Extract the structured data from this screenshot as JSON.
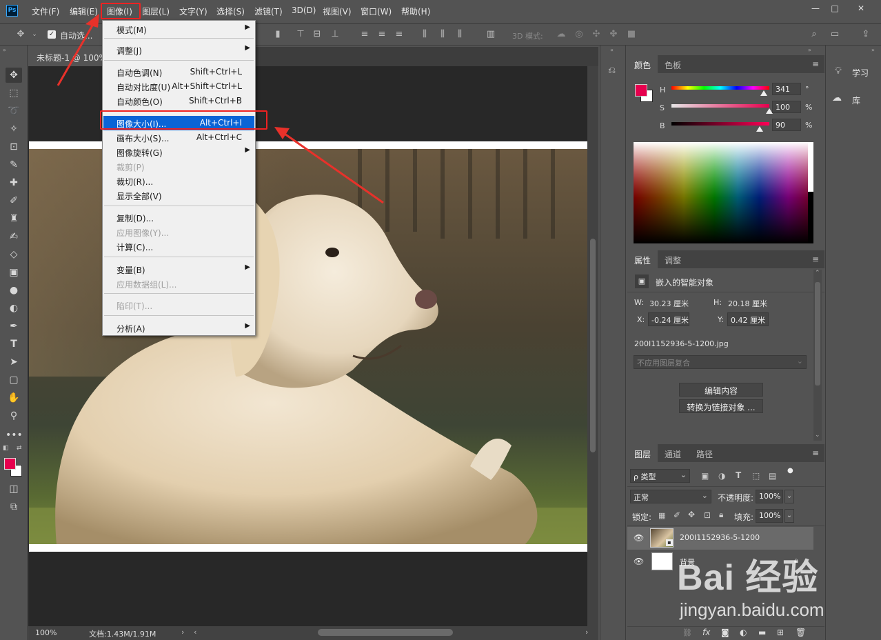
{
  "app": {
    "logo": "Ps"
  },
  "menubar": {
    "items": [
      "文件(F)",
      "编辑(E)",
      "图像(I)",
      "图层(L)",
      "文字(Y)",
      "选择(S)",
      "滤镜(T)",
      "3D(D)",
      "视图(V)",
      "窗口(W)",
      "帮助(H)"
    ],
    "window_controls": [
      "—",
      "□",
      "✕"
    ]
  },
  "options": {
    "auto_select_label": "自动选...",
    "mode_3d": "3D 模式:"
  },
  "document": {
    "tab_title": "未标题-1 @ 100%"
  },
  "status": {
    "zoom": "100%",
    "doc_info": "文档:1.43M/1.91M"
  },
  "image_menu": {
    "items": [
      {
        "label": "模式(M)",
        "shortcut": "",
        "submenu": true,
        "disabled": false
      },
      {
        "label": "调整(J)",
        "shortcut": "",
        "submenu": true,
        "disabled": false
      },
      {
        "label": "自动色调(N)",
        "shortcut": "Shift+Ctrl+L",
        "submenu": false,
        "disabled": false
      },
      {
        "label": "自动对比度(U)",
        "shortcut": "Alt+Shift+Ctrl+L",
        "submenu": false,
        "disabled": false
      },
      {
        "label": "自动颜色(O)",
        "shortcut": "Shift+Ctrl+B",
        "submenu": false,
        "disabled": false
      },
      {
        "label": "图像大小(I)...",
        "shortcut": "Alt+Ctrl+I",
        "submenu": false,
        "disabled": false,
        "highlighted": true
      },
      {
        "label": "画布大小(S)...",
        "shortcut": "Alt+Ctrl+C",
        "submenu": false,
        "disabled": false
      },
      {
        "label": "图像旋转(G)",
        "shortcut": "",
        "submenu": true,
        "disabled": false
      },
      {
        "label": "裁剪(P)",
        "shortcut": "",
        "submenu": false,
        "disabled": true
      },
      {
        "label": "裁切(R)...",
        "shortcut": "",
        "submenu": false,
        "disabled": false
      },
      {
        "label": "显示全部(V)",
        "shortcut": "",
        "submenu": false,
        "disabled": false
      },
      {
        "label": "复制(D)...",
        "shortcut": "",
        "submenu": false,
        "disabled": false
      },
      {
        "label": "应用图像(Y)...",
        "shortcut": "",
        "submenu": false,
        "disabled": true
      },
      {
        "label": "计算(C)...",
        "shortcut": "",
        "submenu": false,
        "disabled": false
      },
      {
        "label": "变量(B)",
        "shortcut": "",
        "submenu": true,
        "disabled": false
      },
      {
        "label": "应用数据组(L)...",
        "shortcut": "",
        "submenu": false,
        "disabled": true
      },
      {
        "label": "陷印(T)...",
        "shortcut": "",
        "submenu": false,
        "disabled": true
      },
      {
        "label": "分析(A)",
        "shortcut": "",
        "submenu": true,
        "disabled": false
      }
    ]
  },
  "color_panel": {
    "tabs": [
      "颜色",
      "色板"
    ],
    "h_label": "H",
    "h_value": "341",
    "h_unit": "°",
    "s_label": "S",
    "s_value": "100",
    "s_unit": "%",
    "b_label": "B",
    "b_value": "90",
    "b_unit": "%",
    "foreground": "#e6004e",
    "h_fraction": 0.947,
    "s_fraction": 1.0,
    "b_fraction": 0.9
  },
  "properties_panel": {
    "tabs": [
      "属性",
      "调整"
    ],
    "type_label": "嵌入的智能对象",
    "w_label": "W:",
    "w_value": "30.23 厘米",
    "h_label": "H:",
    "h_value": "20.18 厘米",
    "x_label": "X:",
    "x_value": "-0.24 厘米",
    "y_label": "Y:",
    "y_value": "0.42 厘米",
    "filename": "200I1152936-5-1200.jpg",
    "comp_placeholder": "不应用图层复合",
    "edit_button": "编辑内容",
    "convert_button": "转换为链接对象 ..."
  },
  "layers_panel": {
    "tabs": [
      "图层",
      "通道",
      "路径"
    ],
    "filter_label": "ρ 类型",
    "blend_mode": "正常",
    "opacity_label": "不透明度:",
    "opacity_value": "100%",
    "lock_label": "锁定:",
    "fill_label": "填充:",
    "fill_value": "100%",
    "layers": [
      {
        "name": "200I1152936-5-1200",
        "visible": true,
        "selected": true
      },
      {
        "name": "背景",
        "visible": true,
        "selected": false,
        "locked": true
      }
    ]
  },
  "far_right": {
    "learn_label": "学习",
    "library_label": "库"
  },
  "watermark": {
    "brand": "Bai 经验",
    "url": "jingyan.baidu.com"
  }
}
